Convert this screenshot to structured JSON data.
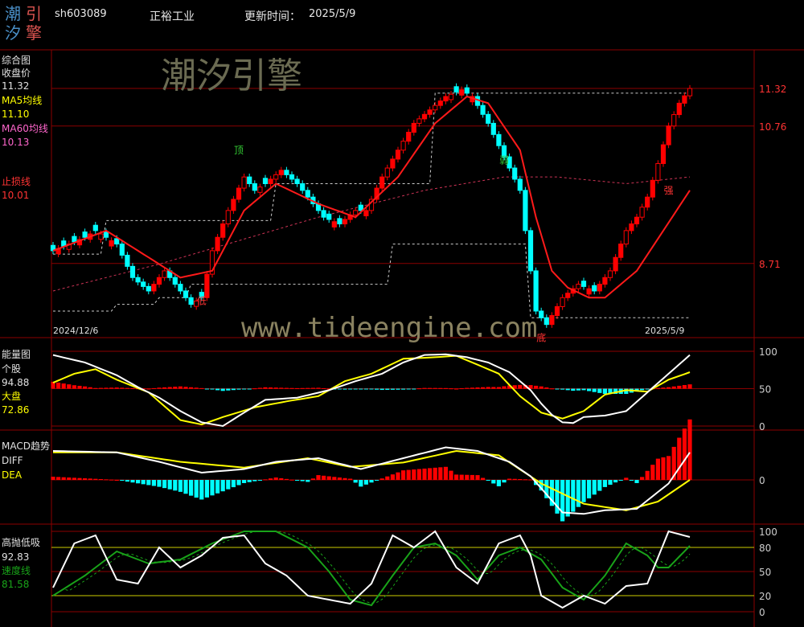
{
  "header": {
    "logo_chars": [
      "潮",
      "引",
      "汐",
      "擎"
    ],
    "code": "sh603089",
    "name": "正裕工业",
    "update_label": "更新时间：",
    "update_date": "2025/5/9"
  },
  "watermarks": {
    "brand": "潮汐引擎",
    "url": "www.tideengine.com"
  },
  "colors": {
    "up": "#ff0000",
    "down": "#00ffff",
    "ma5": "#ffff00",
    "ma60": "#ff3333",
    "stop": "#ff3333",
    "white": "#ffffff",
    "speed": "#19a319",
    "grid": "#8b0000"
  },
  "panels": {
    "main": {
      "title": "综合图",
      "close_label": "收盘价",
      "close_value": "11.32",
      "ma5_label": "MA5均线",
      "ma5_value": "11.10",
      "ma60_label": "MA60均线",
      "ma60_value": "10.13",
      "stop_label": "止损线",
      "stop_value": "10.01",
      "date_start": "2024/12/6",
      "date_end": "2025/5/9",
      "markers": {
        "top": "顶",
        "low": "低",
        "bottom": "底",
        "strong": "强",
        "weak": "弱"
      }
    },
    "energy": {
      "title": "能量图",
      "stock_label": "个股",
      "stock_value": "94.88",
      "market_label": "大盘",
      "market_value": "72.86"
    },
    "macd": {
      "title": "MACD趋势",
      "diff_label": "DIFF",
      "dea_label": "DEA"
    },
    "absorb": {
      "title": "高抛低吸",
      "value": "92.83",
      "speed_label": "速度线",
      "speed_value": "81.58"
    }
  },
  "chart_data": [
    {
      "id": "main",
      "type": "candlestick",
      "x_start": "2024/12/6",
      "x_end": "2025/5/9",
      "y_ticks": [
        11.32,
        10.76,
        8.71
      ],
      "ylim": [
        7.7,
        11.8
      ],
      "close_anchors": [
        [
          0,
          8.9
        ],
        [
          6,
          9.1
        ],
        [
          8,
          9.2
        ],
        [
          12,
          9.0
        ],
        [
          15,
          8.5
        ],
        [
          18,
          8.3
        ],
        [
          21,
          8.6
        ],
        [
          24,
          8.3
        ],
        [
          26,
          8.1
        ],
        [
          28,
          8.2
        ],
        [
          30,
          8.9
        ],
        [
          33,
          9.5
        ],
        [
          36,
          10.0
        ],
        [
          38,
          9.8
        ],
        [
          40,
          9.9
        ],
        [
          43,
          10.1
        ],
        [
          46,
          9.9
        ],
        [
          48,
          9.7
        ],
        [
          51,
          9.4
        ],
        [
          54,
          9.3
        ],
        [
          57,
          9.5
        ],
        [
          59,
          9.5
        ],
        [
          62,
          10.0
        ],
        [
          65,
          10.4
        ],
        [
          68,
          10.8
        ],
        [
          71,
          11.0
        ],
        [
          74,
          11.2
        ],
        [
          77,
          11.3
        ],
        [
          79,
          11.2
        ],
        [
          82,
          10.8
        ],
        [
          85,
          10.3
        ],
        [
          88,
          9.8
        ],
        [
          89,
          9.2
        ],
        [
          91,
          8.0
        ],
        [
          93,
          7.8
        ],
        [
          96,
          8.2
        ],
        [
          99,
          8.4
        ],
        [
          102,
          8.3
        ],
        [
          105,
          8.6
        ],
        [
          108,
          9.2
        ],
        [
          110,
          9.4
        ],
        [
          112,
          9.7
        ],
        [
          114,
          10.2
        ],
        [
          116,
          10.76
        ],
        [
          118,
          11.1
        ],
        [
          120,
          11.32
        ]
      ],
      "ma5_anchors": [
        [
          0,
          8.9
        ],
        [
          10,
          9.2
        ],
        [
          16,
          8.9
        ],
        [
          24,
          8.5
        ],
        [
          30,
          8.6
        ],
        [
          36,
          9.5
        ],
        [
          42,
          9.9
        ],
        [
          50,
          9.6
        ],
        [
          57,
          9.4
        ],
        [
          65,
          10.0
        ],
        [
          72,
          10.8
        ],
        [
          78,
          11.2
        ],
        [
          82,
          11.1
        ],
        [
          88,
          10.4
        ],
        [
          91,
          9.4
        ],
        [
          94,
          8.6
        ],
        [
          97,
          8.35
        ],
        [
          101,
          8.2
        ],
        [
          104,
          8.2
        ],
        [
          110,
          8.6
        ],
        [
          115,
          9.2
        ],
        [
          120,
          9.8
        ]
      ],
      "ma60_anchors": [
        [
          0,
          8.3
        ],
        [
          20,
          8.7
        ],
        [
          50,
          9.4
        ],
        [
          70,
          9.8
        ],
        [
          85,
          10.0
        ],
        [
          95,
          10.0
        ],
        [
          108,
          9.9
        ],
        [
          120,
          10.0
        ]
      ],
      "channel_upper": [
        [
          0,
          8.85
        ],
        [
          10,
          9.35
        ],
        [
          38,
          9.35
        ],
        [
          42,
          9.9
        ],
        [
          68,
          9.9
        ],
        [
          72,
          11.25
        ],
        [
          120,
          11.25
        ]
      ],
      "channel_lower": [
        [
          0,
          8.0
        ],
        [
          12,
          8.1
        ],
        [
          20,
          8.2
        ],
        [
          26,
          8.4
        ],
        [
          60,
          8.4
        ],
        [
          64,
          9.0
        ],
        [
          86,
          9.0
        ],
        [
          90,
          7.9
        ],
        [
          120,
          7.9
        ]
      ],
      "support_resistance": [
        11.32,
        10.76,
        8.71
      ]
    },
    {
      "id": "energy",
      "type": "line+bar",
      "y_ticks": [
        0,
        50,
        100
      ],
      "ylim": [
        0,
        100
      ],
      "stock_anchors": [
        [
          0,
          95
        ],
        [
          6,
          85
        ],
        [
          12,
          68
        ],
        [
          16,
          52
        ],
        [
          20,
          38
        ],
        [
          24,
          20
        ],
        [
          28,
          5
        ],
        [
          32,
          0
        ],
        [
          36,
          18
        ],
        [
          40,
          35
        ],
        [
          46,
          38
        ],
        [
          52,
          48
        ],
        [
          57,
          60
        ],
        [
          62,
          70
        ],
        [
          66,
          85
        ],
        [
          70,
          95
        ],
        [
          74,
          96
        ],
        [
          78,
          92
        ],
        [
          82,
          85
        ],
        [
          86,
          72
        ],
        [
          88,
          60
        ],
        [
          90,
          48
        ],
        [
          92,
          30
        ],
        [
          94,
          15
        ],
        [
          96,
          5
        ],
        [
          98,
          4
        ],
        [
          100,
          12
        ],
        [
          104,
          14
        ],
        [
          108,
          20
        ],
        [
          112,
          45
        ],
        [
          116,
          70
        ],
        [
          120,
          95
        ]
      ],
      "market_anchors": [
        [
          0,
          58
        ],
        [
          4,
          70
        ],
        [
          8,
          76
        ],
        [
          12,
          62
        ],
        [
          18,
          45
        ],
        [
          24,
          8
        ],
        [
          28,
          2
        ],
        [
          32,
          12
        ],
        [
          38,
          25
        ],
        [
          44,
          33
        ],
        [
          50,
          40
        ],
        [
          55,
          60
        ],
        [
          60,
          70
        ],
        [
          66,
          90
        ],
        [
          72,
          92
        ],
        [
          76,
          94
        ],
        [
          80,
          82
        ],
        [
          84,
          70
        ],
        [
          88,
          40
        ],
        [
          92,
          18
        ],
        [
          96,
          10
        ],
        [
          100,
          20
        ],
        [
          104,
          42
        ],
        [
          108,
          48
        ],
        [
          112,
          46
        ],
        [
          116,
          62
        ],
        [
          120,
          72
        ]
      ]
    },
    {
      "id": "macd",
      "type": "line+bar",
      "y_ticks": [
        0
      ],
      "diff_anchors": [
        [
          0,
          0.4
        ],
        [
          12,
          0.38
        ],
        [
          20,
          0.25
        ],
        [
          28,
          0.1
        ],
        [
          36,
          0.15
        ],
        [
          42,
          0.25
        ],
        [
          50,
          0.3
        ],
        [
          58,
          0.15
        ],
        [
          66,
          0.3
        ],
        [
          74,
          0.45
        ],
        [
          80,
          0.4
        ],
        [
          86,
          0.25
        ],
        [
          90,
          0.05
        ],
        [
          96,
          -0.45
        ],
        [
          100,
          -0.47
        ],
        [
          104,
          -0.42
        ],
        [
          110,
          -0.4
        ],
        [
          116,
          -0.05
        ],
        [
          120,
          0.38
        ]
      ],
      "dea_anchors": [
        [
          0,
          0.38
        ],
        [
          12,
          0.38
        ],
        [
          24,
          0.25
        ],
        [
          36,
          0.17
        ],
        [
          48,
          0.3
        ],
        [
          56,
          0.18
        ],
        [
          66,
          0.24
        ],
        [
          76,
          0.4
        ],
        [
          84,
          0.34
        ],
        [
          92,
          -0.05
        ],
        [
          100,
          -0.33
        ],
        [
          108,
          -0.42
        ],
        [
          114,
          -0.3
        ],
        [
          120,
          0.0
        ]
      ]
    },
    {
      "id": "absorb",
      "type": "line",
      "y_ticks": [
        100,
        80,
        50,
        20,
        0
      ],
      "ylim": [
        0,
        100
      ],
      "white_anchors": [
        [
          0,
          30
        ],
        [
          4,
          85
        ],
        [
          8,
          95
        ],
        [
          12,
          40
        ],
        [
          16,
          35
        ],
        [
          20,
          80
        ],
        [
          24,
          55
        ],
        [
          28,
          70
        ],
        [
          32,
          92
        ],
        [
          36,
          95
        ],
        [
          40,
          60
        ],
        [
          44,
          45
        ],
        [
          48,
          20
        ],
        [
          52,
          15
        ],
        [
          56,
          10
        ],
        [
          60,
          35
        ],
        [
          64,
          95
        ],
        [
          68,
          80
        ],
        [
          72,
          100
        ],
        [
          76,
          55
        ],
        [
          80,
          35
        ],
        [
          84,
          85
        ],
        [
          88,
          95
        ],
        [
          90,
          70
        ],
        [
          92,
          20
        ],
        [
          96,
          5
        ],
        [
          100,
          20
        ],
        [
          104,
          10
        ],
        [
          108,
          32
        ],
        [
          112,
          35
        ],
        [
          116,
          100
        ],
        [
          120,
          93
        ]
      ],
      "green_anchors": [
        [
          0,
          20
        ],
        [
          6,
          45
        ],
        [
          12,
          75
        ],
        [
          18,
          60
        ],
        [
          24,
          65
        ],
        [
          30,
          85
        ],
        [
          36,
          100
        ],
        [
          42,
          100
        ],
        [
          48,
          80
        ],
        [
          52,
          50
        ],
        [
          56,
          15
        ],
        [
          60,
          8
        ],
        [
          64,
          45
        ],
        [
          68,
          80
        ],
        [
          72,
          85
        ],
        [
          76,
          70
        ],
        [
          80,
          40
        ],
        [
          84,
          70
        ],
        [
          88,
          80
        ],
        [
          92,
          65
        ],
        [
          96,
          30
        ],
        [
          100,
          15
        ],
        [
          104,
          45
        ],
        [
          108,
          85
        ],
        [
          112,
          70
        ],
        [
          114,
          55
        ],
        [
          116,
          55
        ],
        [
          120,
          82
        ]
      ]
    }
  ]
}
